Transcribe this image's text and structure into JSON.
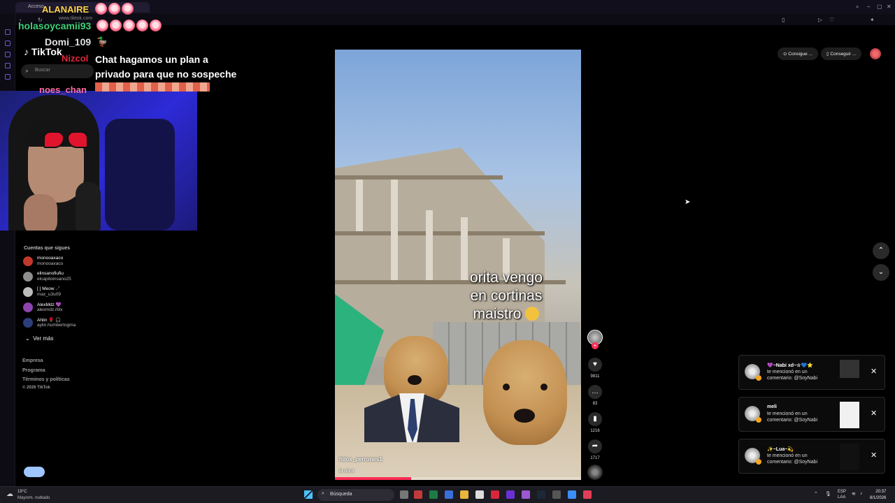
{
  "browser": {
    "tab_title": "Acceso",
    "url": "www.tiktok.com"
  },
  "tiktok": {
    "logo": "TikTok",
    "search_placeholder": "Buscar",
    "following_heading": "Cuentas que sigues",
    "following": [
      {
        "name": "monooaxaco",
        "user": "monooaxaco",
        "color": "#c0392b"
      },
      {
        "name": "elinsanofiufiu",
        "user": "elcapitoinsano25",
        "color": "#8e8e8e"
      },
      {
        "name": "[ ] Meow .·˚",
        "user": "max_u3u09",
        "color": "#bbbbbb"
      },
      {
        "name": "AlexMdz 💜",
        "user": "alexmdz.rblx",
        "color": "#8e44ad"
      },
      {
        "name": "Ahlin 🌹 🎧",
        "user": "aylin.humbertogma",
        "color": "#2c3e7a"
      }
    ],
    "ver_mas": "Ver más",
    "footer": [
      "Empresa",
      "Programa",
      "Términos y políticas",
      "© 2026 TikTok"
    ],
    "top_buttons": [
      "Consigue ...",
      "Conseguir ..."
    ]
  },
  "chat_overlay": {
    "streamer": "ALANAIRE",
    "messages": [
      {
        "user": "holasoycamii93",
        "color": "#3fd17a"
      },
      {
        "user": "Domi_109",
        "color": "#e0e0e0"
      },
      {
        "user": "Nizcol",
        "color": "#e0283b",
        "text": "Chat hagamos un plan a privado para que no sospeche"
      },
      {
        "user": "noes_chan",
        "color": "#ff6fa3"
      }
    ]
  },
  "video": {
    "caption_line1": "orita vengo",
    "caption_line2": "en cortinas",
    "caption_line3": "maistro",
    "username": "hilos_perrones1",
    "description": "la obra",
    "progress": 0.31,
    "likes": "9811",
    "comments": "83",
    "saves": "1216",
    "shares": "1717"
  },
  "notifications": [
    {
      "title": "💜~Nabi xd~☆💙⭐",
      "line1": "te mencionó en un",
      "line2": "comentario: @SoyNabi"
    },
    {
      "title": "meli",
      "line1": "te mencionó en un",
      "line2": "comentario: @SoyNabi"
    },
    {
      "title": "✨~Lua~💫",
      "line1": "te mencionó en un",
      "line2": "comentario: @SoyNabi"
    }
  ],
  "taskbar": {
    "temp": "19°C",
    "weather": "Mayorm. nublado",
    "search": "Búsqueda",
    "lang1": "ESP",
    "lang2": "LAA",
    "time": "20:37",
    "date": "8/1/2026"
  }
}
